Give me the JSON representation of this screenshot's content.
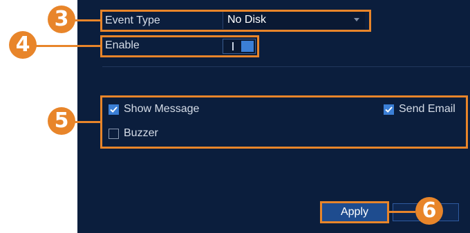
{
  "callouts": {
    "event_type_badge": "3",
    "enable_badge": "4",
    "options_badge": "5",
    "apply_badge": "6",
    "accent_color": "#e8852a"
  },
  "form": {
    "event_type_label": "Event Type",
    "event_type_value": "No Disk",
    "enable_label": "Enable",
    "enable_state": true,
    "toggle_glyph": "I"
  },
  "options": {
    "show_message": {
      "label": "Show Message",
      "checked": true
    },
    "send_email": {
      "label": "Send Email",
      "checked": true
    },
    "buzzer": {
      "label": "Buzzer",
      "checked": false
    }
  },
  "buttons": {
    "apply_label": "Apply"
  },
  "colors": {
    "panel_bg": "#0b1e3d",
    "checkbox_checked": "#3b7fd6",
    "text": "#d6dde8"
  }
}
